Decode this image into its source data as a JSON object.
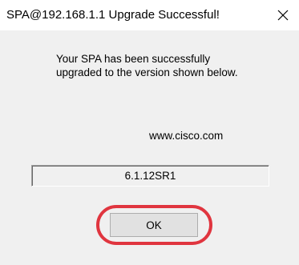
{
  "window": {
    "title": "SPA@192.168.1.1 Upgrade Successful!",
    "close_icon": "close-icon"
  },
  "dialog": {
    "message": "Your SPA has been successfully upgraded to the version shown below.",
    "link_text": "www.cisco.com",
    "version": "6.1.12SR1",
    "ok_label": "OK"
  },
  "colors": {
    "highlight": "#e0353f",
    "dialog_bg": "#f0f0f0",
    "titlebar_bg": "#ffffff"
  }
}
